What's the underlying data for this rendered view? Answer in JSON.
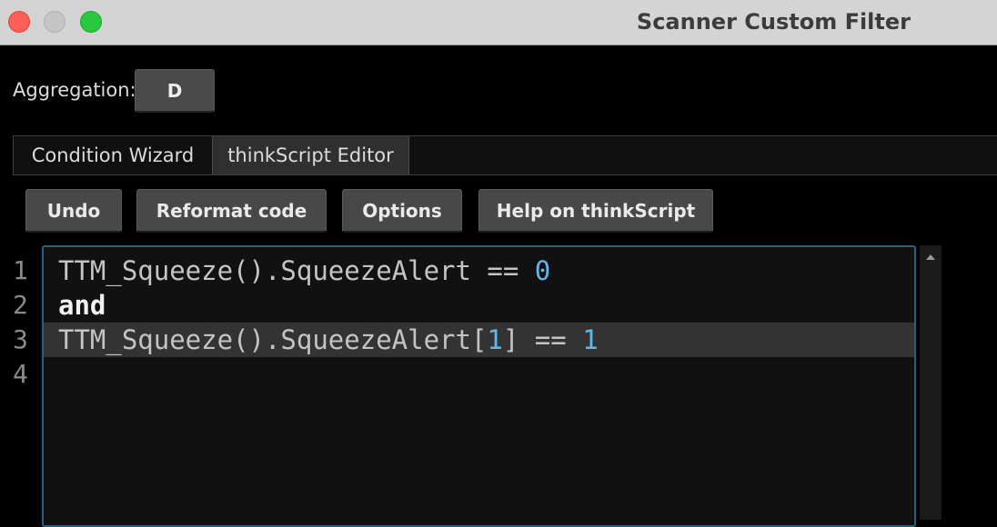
{
  "window": {
    "title": "Scanner Custom Filter"
  },
  "aggregation": {
    "label": "Aggregation:",
    "value": "D"
  },
  "tabs": [
    {
      "label": "Condition Wizard",
      "active": false
    },
    {
      "label": "thinkScript Editor",
      "active": true
    }
  ],
  "toolbar": {
    "undo": "Undo",
    "reformat": "Reformat code",
    "options": "Options",
    "help": "Help on thinkScript"
  },
  "editor": {
    "line_numbers": [
      "1",
      "2",
      "3",
      "4"
    ],
    "highlighted_line": 3,
    "lines": [
      {
        "prefix": "TTM_Squeeze().SqueezeAlert == ",
        "number": "0"
      },
      {
        "keyword": "and"
      },
      {
        "prefix": "TTM_Squeeze().SqueezeAlert[",
        "index": "1",
        "middle": "] == ",
        "number": "1"
      },
      {
        "text": ""
      }
    ]
  },
  "colors": {
    "number": "#64b5ec",
    "editor_border": "#2a5f80",
    "highlight_line": "#333333"
  }
}
